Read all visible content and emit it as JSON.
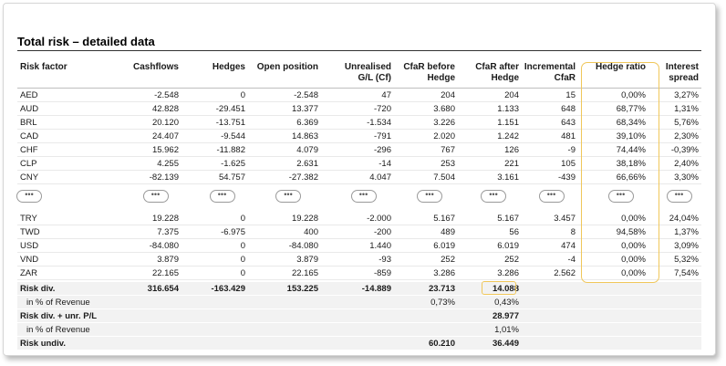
{
  "title": "Total risk – detailed data",
  "colors": {
    "highlight": "#f0c75a",
    "summary_bg": "#f2f2f2"
  },
  "headers": {
    "risk_factor": "Risk factor",
    "cashflows": "Cashflows",
    "hedges": "Hedges",
    "open_position": "Open position",
    "unrealised_1": "Unrealised",
    "unrealised_2": "G/L (Cf)",
    "cfar_before_1": "CfaR before",
    "cfar_before_2": "Hedge",
    "cfar_after_1": "CfaR after",
    "cfar_after_2": "Hedge",
    "incremental_1": "Incremental",
    "incremental_2": "CfaR",
    "hedge_ratio": "Hedge ratio",
    "interest_1": "Interest",
    "interest_2": "spread"
  },
  "rows_top": [
    [
      "AED",
      "-2.548",
      "0",
      "-2.548",
      "47",
      "204",
      "204",
      "15",
      "0,00%",
      "3,27%"
    ],
    [
      "AUD",
      "42.828",
      "-29.451",
      "13.377",
      "-720",
      "3.680",
      "1.133",
      "648",
      "68,77%",
      "1,31%"
    ],
    [
      "BRL",
      "20.120",
      "-13.751",
      "6.369",
      "-1.534",
      "3.226",
      "1.151",
      "643",
      "68,34%",
      "5,76%"
    ],
    [
      "CAD",
      "24.407",
      "-9.544",
      "14.863",
      "-791",
      "2.020",
      "1.242",
      "481",
      "39,10%",
      "2,30%"
    ],
    [
      "CHF",
      "15.962",
      "-11.882",
      "4.079",
      "-296",
      "767",
      "126",
      "-9",
      "74,44%",
      "-0,39%"
    ],
    [
      "CLP",
      "4.255",
      "-1.625",
      "2.631",
      "-14",
      "253",
      "221",
      "105",
      "38,18%",
      "2,40%"
    ],
    [
      "CNY",
      "-82.139",
      "54.757",
      "-27.382",
      "4.047",
      "7.504",
      "3.161",
      "-439",
      "66,66%",
      "3,30%"
    ]
  ],
  "ellipsis": "•••",
  "rows_bottom": [
    [
      "TRY",
      "19.228",
      "0",
      "19.228",
      "-2.000",
      "5.167",
      "5.167",
      "3.457",
      "0,00%",
      "24,04%"
    ],
    [
      "TWD",
      "7.375",
      "-6.975",
      "400",
      "-200",
      "489",
      "56",
      "8",
      "94,58%",
      "1,37%"
    ],
    [
      "USD",
      "-84.080",
      "0",
      "-84.080",
      "1.440",
      "6.019",
      "6.019",
      "474",
      "0,00%",
      "3,09%"
    ],
    [
      "VND",
      "3.879",
      "0",
      "3.879",
      "-93",
      "252",
      "252",
      "-4",
      "0,00%",
      "5,32%"
    ],
    [
      "ZAR",
      "22.165",
      "0",
      "22.165",
      "-859",
      "3.286",
      "3.286",
      "2.562",
      "0,00%",
      "7,54%"
    ]
  ],
  "summary": {
    "risk_div": {
      "label": "Risk div.",
      "cashflows": "316.654",
      "hedges": "-163.429",
      "open_position": "153.225",
      "unrealised": "-14.889",
      "cfar_before": "23.713",
      "cfar_after": "14.088"
    },
    "pct_revenue_1": {
      "label": "in % of Revenue",
      "cfar_before": "0,73%",
      "cfar_after": "0,43%"
    },
    "risk_div_unr": {
      "label": "Risk div. + unr. P/L",
      "cfar_after": "28.977"
    },
    "pct_revenue_2": {
      "label": "in % of Revenue",
      "cfar_after": "1,01%"
    },
    "risk_undiv": {
      "label": "Risk undiv.",
      "cfar_before": "60.210",
      "cfar_after": "36.449"
    }
  }
}
